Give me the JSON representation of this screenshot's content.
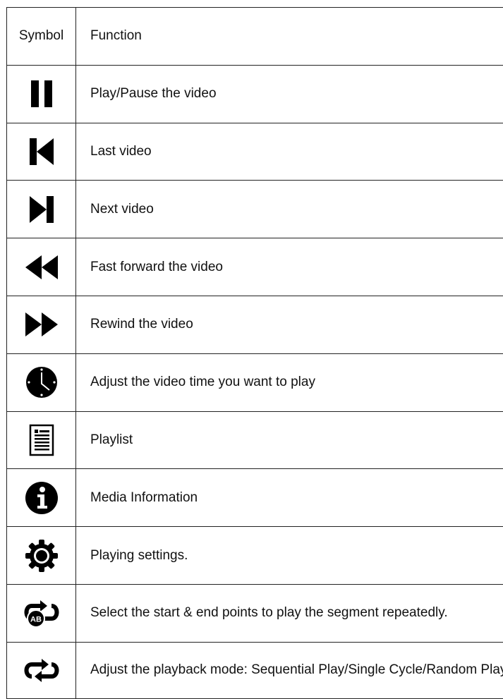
{
  "header": {
    "symbol": "Symbol",
    "function": "Function"
  },
  "rows": [
    {
      "icon": "pause-icon",
      "text": "Play/Pause the video"
    },
    {
      "icon": "skip-previous-icon",
      "text": "Last video"
    },
    {
      "icon": "skip-next-icon",
      "text": "Next video"
    },
    {
      "icon": "double-arrow-left-icon",
      "text": "Fast forward the video"
    },
    {
      "icon": "double-arrow-right-icon",
      "text": "Rewind the video"
    },
    {
      "icon": "clock-icon",
      "text": "Adjust the video time you want to play"
    },
    {
      "icon": "playlist-icon",
      "text": "Playlist"
    },
    {
      "icon": "info-icon",
      "text": "Media Information"
    },
    {
      "icon": "gear-icon",
      "text": "Playing settings."
    },
    {
      "icon": "ab-repeat-icon",
      "text": "Select the start & end points to play the segment repeatedly."
    },
    {
      "icon": "repeat-icon",
      "text": "Adjust the playback mode: Sequential Play/Single Cycle/Random Play"
    }
  ]
}
